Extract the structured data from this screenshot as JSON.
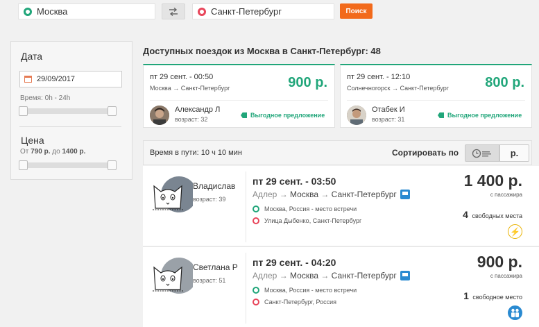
{
  "search": {
    "from": "Москва",
    "to": "Санкт-Петербург",
    "button": "Поиск"
  },
  "filters": {
    "date_title": "Дата",
    "date_value": "29/09/2017",
    "time_label": "Время: 0h - 24h",
    "price_title": "Цена",
    "price_prefix": "От",
    "price_min": "790 р.",
    "price_mid": "до",
    "price_max": "1400 р."
  },
  "main": {
    "title": "Доступных поездок из Москва в Санкт-Петербург: 48"
  },
  "offers": [
    {
      "when": "пт 29 сент. - 00:50",
      "route_from": "Москва",
      "route_to": "Санкт-Петербург",
      "price": "900 р.",
      "name": "Александр Л",
      "age": "возраст: 32",
      "deal": "Выгодное предложение"
    },
    {
      "when": "пт 29 сент. - 12:10",
      "route_from": "Солнечногорск",
      "route_to": "Санкт-Петербург",
      "price": "800 р.",
      "name": "Отабек И",
      "age": "возраст: 31",
      "deal": "Выгодное предложение"
    }
  ],
  "sortbar": {
    "duration": "Время в пути: 10 ч 10 мин",
    "sort_label": "Сортировать по",
    "price_option": "р."
  },
  "trips": [
    {
      "driver": "Владислав",
      "age": "возраст: 39",
      "when": "пт 29 сент. - 03:50",
      "stop1": "Адлер",
      "stop2": "Москва",
      "stop3": "Санкт-Петербург",
      "meet": "Москва, Россия - место встречи",
      "dest": "Улица Дыбенко, Санкт-Петербург",
      "price": "1 400 р.",
      "per": "с пассажира",
      "seats_count": "4",
      "seats_text": "свободных места"
    },
    {
      "driver": "Светлана Р",
      "age": "возраст: 51",
      "when": "пт 29 сент. - 04:20",
      "stop1": "Адлер",
      "stop2": "Москва",
      "stop3": "Санкт-Петербург",
      "meet": "Москва, Россия - место встречи",
      "dest": "Санкт-Петербург, Россия",
      "price": "900 р.",
      "per": "с пассажира",
      "seats_count": "1",
      "seats_text": "свободное место"
    }
  ],
  "colors": {
    "accent_green": "#21a67a",
    "accent_red": "#e8465b",
    "search_orange": "#f26a1b",
    "bus_blue": "#2a8ad1"
  }
}
